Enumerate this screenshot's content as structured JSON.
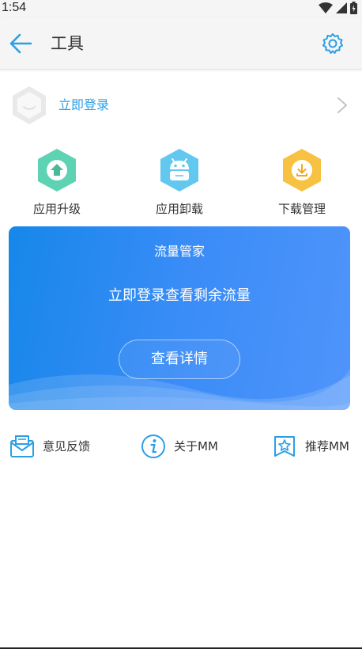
{
  "status_bar": {
    "time": "1:54"
  },
  "header": {
    "title": "工具"
  },
  "login": {
    "label": "立即登录"
  },
  "tools": [
    {
      "label": "应用升级",
      "icon": "upgrade-icon",
      "color": "#5dd3b4"
    },
    {
      "label": "应用卸载",
      "icon": "android-icon",
      "color": "#63c8ef"
    },
    {
      "label": "下载管理",
      "icon": "download-icon",
      "color": "#f7c242"
    }
  ],
  "flow_card": {
    "title": "流量管家",
    "message": "立即登录查看剩余流量",
    "button_label": "查看详情"
  },
  "bottom_items": [
    {
      "label": "意见反馈",
      "icon": "feedback-icon"
    },
    {
      "label": "关于MM",
      "icon": "info-icon"
    },
    {
      "label": "推荐MM",
      "icon": "recommend-icon"
    }
  ],
  "colors": {
    "accent": "#2a9fe6",
    "card_gradient_start": "#1687ea",
    "card_gradient_end": "#4f94fb"
  }
}
